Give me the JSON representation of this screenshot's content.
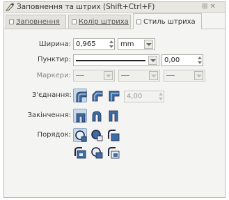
{
  "window": {
    "title": "Заповнення та штрих (Shift+Ctrl+F)",
    "controls": "⊞ ✕"
  },
  "tabs": [
    {
      "label": "Заповнення",
      "active": false
    },
    {
      "label": "Колір штриха",
      "active": false
    },
    {
      "label": "Стиль штриха",
      "active": true
    }
  ],
  "stroke_style": {
    "width_label": "Ширина:",
    "width_value": "0,965",
    "unit": "mm",
    "dash_label": "Пунктир:",
    "dash_offset": "0,00",
    "markers_label": "Маркери:",
    "markers": [
      "—",
      "—",
      "—"
    ],
    "join_label": "З'єднання:",
    "join_buttons": [
      "round-join-icon",
      "bevel-join-icon",
      "miter-join-icon"
    ],
    "miter_limit": "4,00",
    "cap_label": "Закінчення:",
    "cap_buttons": [
      "butt-cap-icon",
      "round-cap-icon",
      "square-cap-icon"
    ],
    "order_label": "Порядок:",
    "order_buttons": [
      "order-1-icon",
      "order-2-icon",
      "order-3-icon",
      "order-4-icon",
      "order-5-icon",
      "order-6-icon"
    ]
  },
  "colors": {
    "accent": "#3c6ea5",
    "selected_bg": "#c9d9ea"
  }
}
